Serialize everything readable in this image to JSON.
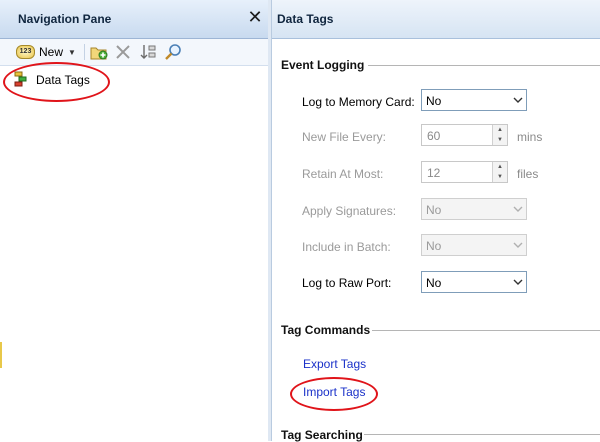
{
  "nav": {
    "title": "Navigation Pane",
    "close_glyph": "✕",
    "toolbar": {
      "new_badge": "123",
      "new_label": "New",
      "icons": [
        "new-tag-icon",
        "new-folder-icon",
        "delete-icon",
        "sort-icon",
        "search-icon"
      ]
    },
    "tree": [
      {
        "label": "Data Tags",
        "icon": "data-tags-icon"
      }
    ]
  },
  "panel": {
    "title": "Data Tags",
    "event_logging": {
      "title": "Event Logging",
      "rows": [
        {
          "label": "Log to Memory Card:",
          "value": "No",
          "enabled": true,
          "kind": "dropdown"
        },
        {
          "label": "New File Every:",
          "value": "60",
          "unit": "mins",
          "enabled": false,
          "kind": "spin"
        },
        {
          "label": "Retain At Most:",
          "value": "12",
          "unit": "files",
          "enabled": false,
          "kind": "spin"
        },
        {
          "label": "Apply Signatures:",
          "value": "No",
          "enabled": false,
          "kind": "dropdown"
        },
        {
          "label": "Include in Batch:",
          "value": "No",
          "enabled": false,
          "kind": "dropdown"
        },
        {
          "label": "Log to Raw Port:",
          "value": "No",
          "enabled": true,
          "kind": "dropdown"
        }
      ]
    },
    "tag_commands": {
      "title": "Tag Commands",
      "links": [
        "Export Tags",
        "Import Tags"
      ]
    },
    "tag_searching": {
      "title": "Tag Searching"
    }
  },
  "colors": {
    "link": "#1a31c9",
    "highlight_oval": "#e0141a",
    "header_gradient": "#c8daef"
  }
}
